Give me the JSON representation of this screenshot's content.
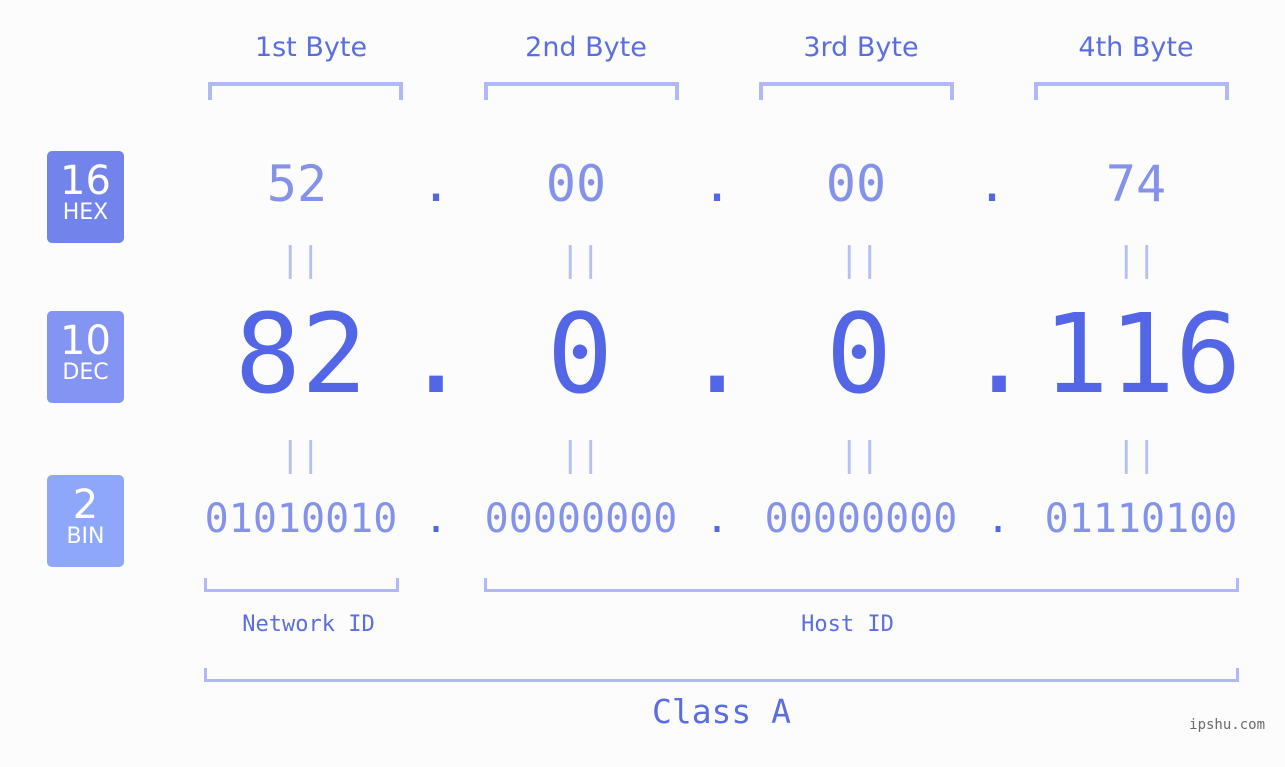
{
  "bytes": [
    {
      "header": "1st Byte",
      "hex": "52",
      "dec": "82",
      "bin": "01010010"
    },
    {
      "header": "2nd Byte",
      "hex": "00",
      "dec": "0",
      "bin": "00000000"
    },
    {
      "header": "3rd Byte",
      "hex": "00",
      "dec": "0",
      "bin": "00000000"
    },
    {
      "header": "4th Byte",
      "hex": "74",
      "dec": "116",
      "bin": "01110100"
    }
  ],
  "separator": ".",
  "equals": "||",
  "badges": {
    "hex": {
      "num": "16",
      "label": "HEX",
      "color": "#7283ec"
    },
    "dec": {
      "num": "10",
      "label": "DEC",
      "color": "#8494f2"
    },
    "bin": {
      "num": "2",
      "label": "BIN",
      "color": "#8ea7fb"
    }
  },
  "segments": {
    "network": "Network ID",
    "host": "Host ID"
  },
  "ip_class": "Class A",
  "watermark": "ipshu.com",
  "colors": {
    "accent": "#5266e6",
    "light": "#8592ea",
    "bracket": "#b0b9f6"
  }
}
